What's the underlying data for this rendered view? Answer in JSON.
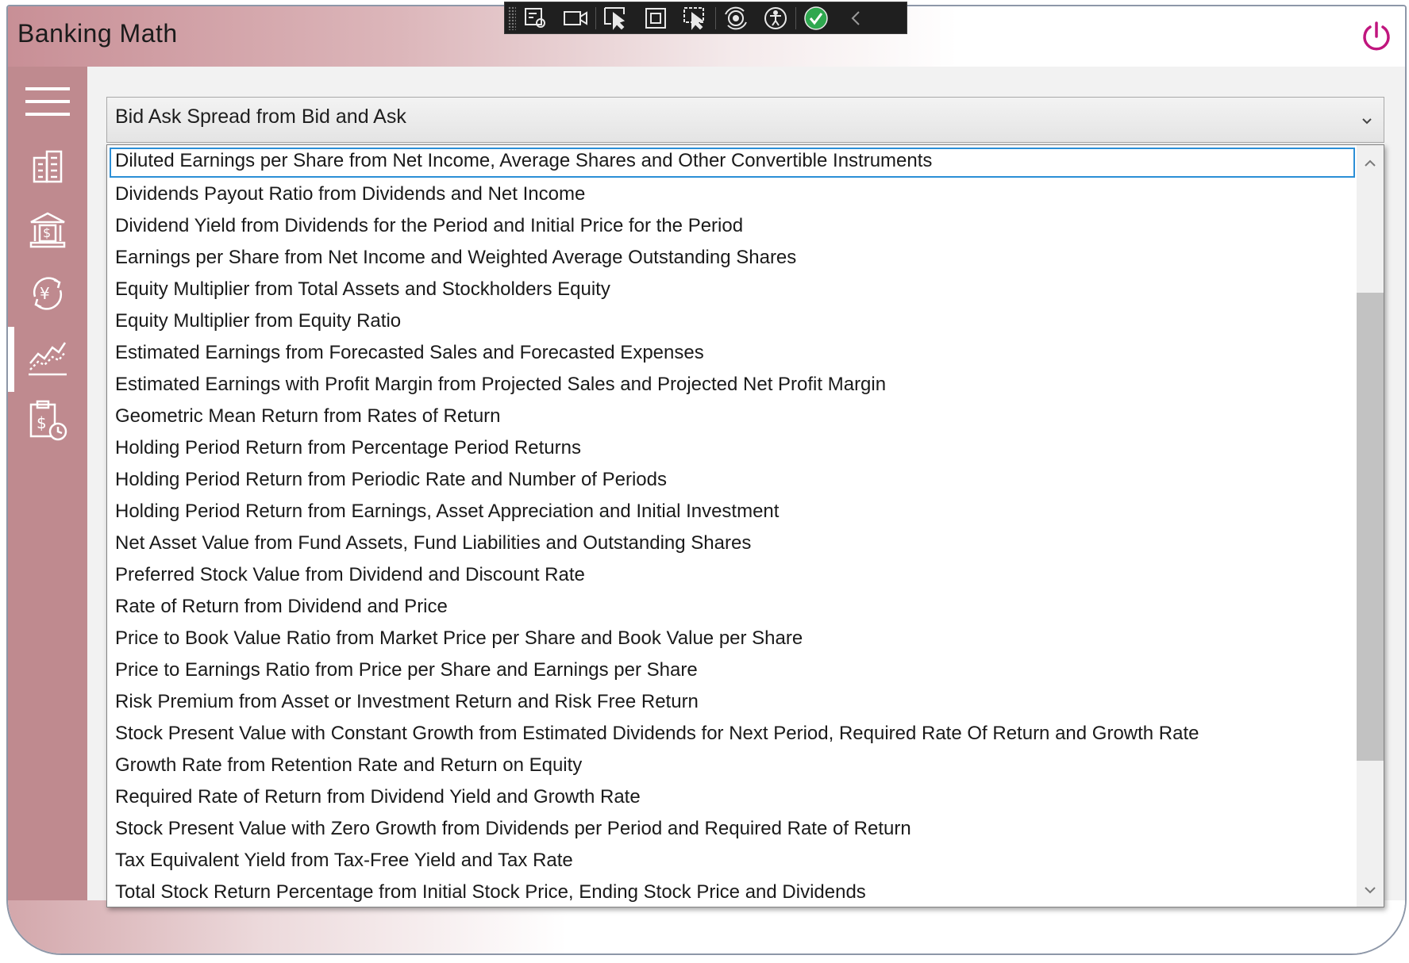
{
  "app": {
    "title": "Banking Math",
    "power_icon": "power-icon",
    "accent": "#c0167e"
  },
  "sidebar": {
    "bg": "#bf8a8f",
    "items": [
      {
        "icon": "hamburger-menu-icon"
      },
      {
        "icon": "building-icon"
      },
      {
        "icon": "bank-icon"
      },
      {
        "icon": "currency-exchange-icon"
      },
      {
        "icon": "stock-chart-icon",
        "active": true
      },
      {
        "icon": "dollar-clipboard-clock-icon"
      }
    ]
  },
  "debug_toolbar": {
    "icons": [
      "select-element-icon",
      "video-icon",
      "pointer-select-icon",
      "layout-adorner-icon",
      "track-focus-icon",
      "hot-reload-icon",
      "accessibility-icon",
      "check-icon",
      "collapse-chevron-icon"
    ]
  },
  "combo": {
    "selected": "Bid Ask Spread from Bid and Ask"
  },
  "dropdown": {
    "items": [
      "Diluted Earnings per Share from Net Income, Average Shares and Other Convertible Instruments",
      "Dividends Payout Ratio from Dividends and Net Income",
      "Dividend Yield from Dividends for the Period and Initial Price for the Period",
      "Earnings per Share from Net Income and Weighted Average Outstanding Shares",
      "Equity Multiplier from Total Assets and Stockholders Equity",
      "Equity Multiplier from Equity Ratio",
      "Estimated Earnings from Forecasted Sales and Forecasted Expenses",
      "Estimated Earnings with Profit Margin from Projected Sales and Projected Net Profit Margin",
      "Geometric Mean Return from Rates of Return",
      "Holding Period Return from Percentage Period Returns",
      "Holding Period Return from Periodic Rate and Number of Periods",
      "Holding Period Return from Earnings, Asset Appreciation and Initial Investment",
      "Net Asset Value from Fund Assets, Fund Liabilities and Outstanding Shares",
      "Preferred Stock Value from Dividend and Discount Rate",
      "Rate of Return from Dividend and Price",
      "Price to Book Value Ratio from Market Price per Share and Book Value per Share",
      "Price to Earnings Ratio from Price per Share and Earnings per Share",
      "Risk Premium from Asset or Investment Return and Risk Free Return",
      "Stock Present Value with Constant Growth from Estimated Dividends for Next Period, Required Rate Of Return and Growth Rate",
      "Growth Rate from Retention Rate and Return on Equity",
      "Required Rate of Return from Dividend Yield and Growth Rate",
      "Stock Present Value with Zero Growth from Dividends per Period and Required Rate of Return",
      "Tax Equivalent Yield from Tax-Free Yield and Tax Rate",
      "Total Stock Return Percentage from Initial Stock Price, Ending Stock Price and Dividends"
    ],
    "selected_index": 0
  }
}
